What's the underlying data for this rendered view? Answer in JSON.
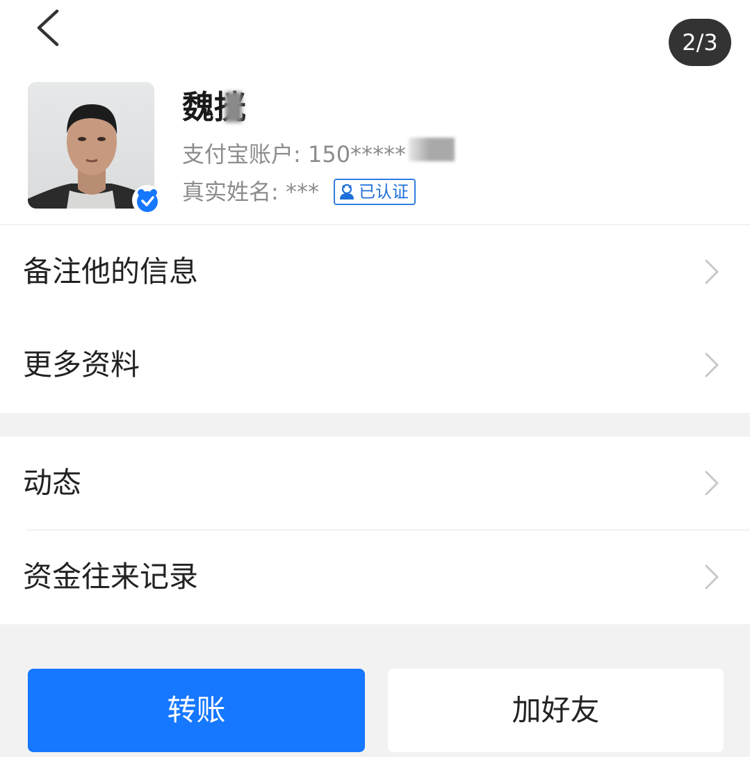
{
  "header": {
    "page_indicator": "2/3",
    "name": "魏挄",
    "account_label": "支付宝账户: ",
    "account_value": "150*****",
    "realname_label": "真实姓名: ",
    "realname_value": "***",
    "certified_label": "已认证"
  },
  "menu": {
    "section1": [
      {
        "label": "备注他的信息"
      },
      {
        "label": "更多资料"
      }
    ],
    "section2": [
      {
        "label": "动态"
      },
      {
        "label": "资金往来记录"
      }
    ]
  },
  "buttons": {
    "transfer": "转账",
    "add_friend": "加好友"
  },
  "colors": {
    "primary": "#1677ff",
    "badge": "#2f7fe0",
    "background": "#f2f2f2"
  },
  "icons": [
    "back-icon",
    "verified-icon",
    "certified-icon",
    "chevron-right-icon"
  ]
}
